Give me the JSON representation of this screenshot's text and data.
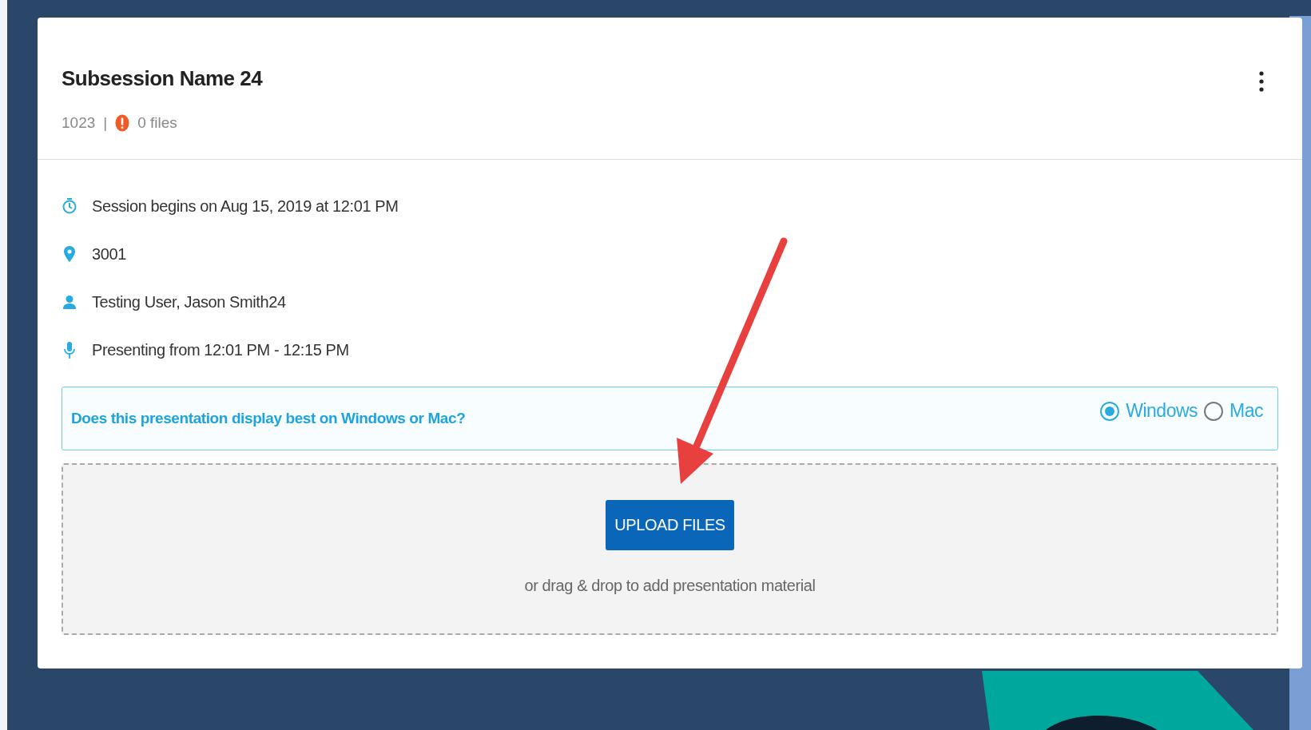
{
  "session": {
    "title": "Subsession Name 24",
    "code": "1023",
    "separator": "|",
    "files": "0 files",
    "warning": true
  },
  "info": [
    {
      "kind": "clock",
      "text": "Session begins on Aug 15, 2019 at 12:01 PM"
    },
    {
      "kind": "pin",
      "text": "3001"
    },
    {
      "kind": "person",
      "text": "Testing User, Jason Smith24"
    },
    {
      "kind": "mic",
      "text": "Presenting from 12:01 PM - 12:15 PM"
    }
  ],
  "question": {
    "text": "Does this presentation display best on Windows or Mac?",
    "options": [
      {
        "label": "Windows",
        "selected": true
      },
      {
        "label": "Mac",
        "selected": false
      }
    ]
  },
  "upload": {
    "button": "UPLOAD FILES",
    "hint": "or drag & drop to add presentation material"
  }
}
